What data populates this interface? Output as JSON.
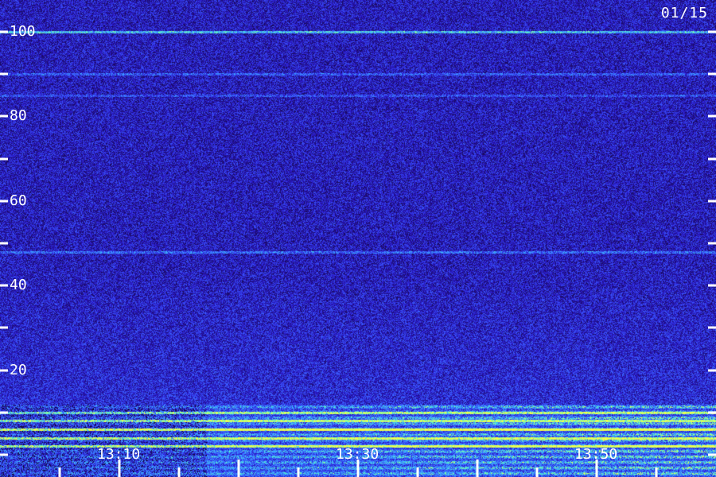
{
  "date_label": "01/15",
  "chart_data": {
    "type": "heatmap",
    "title": "",
    "xlabel": "",
    "ylabel": "",
    "ylim": [
      0,
      100
    ],
    "y_ticks_labeled": [
      "20",
      "40",
      "60",
      "80",
      "100"
    ],
    "y_ticks_minor": [
      10,
      30,
      50,
      70,
      90
    ],
    "x_tick_labels": [
      "13:10",
      "13:30",
      "13:50"
    ],
    "x_range": [
      "13:00",
      "14:00"
    ],
    "grid": false,
    "colormap": [
      "#000000",
      "#1a0a5e",
      "#2a18c8",
      "#3b5cff",
      "#39b8ff",
      "#6dffb0",
      "#f4ff4a"
    ],
    "bands": [
      {
        "y": 100,
        "intensity": 0.55
      },
      {
        "y": 90,
        "intensity": 0.25
      },
      {
        "y": 85,
        "intensity": 0.2
      },
      {
        "y": 48,
        "intensity": 0.3
      },
      {
        "y": 10,
        "intensity": 0.5
      },
      {
        "y": 8,
        "intensity": 0.75
      },
      {
        "y": 6,
        "intensity": 0.85
      },
      {
        "y": 4,
        "intensity": 0.8
      },
      {
        "y": 2,
        "intensity": 0.7
      }
    ]
  }
}
